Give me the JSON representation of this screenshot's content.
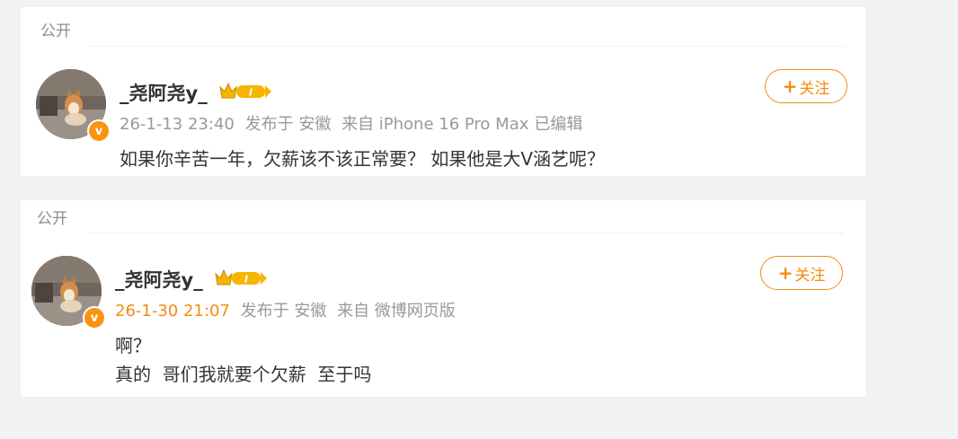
{
  "colors": {
    "accent": "#f48c10",
    "verified": "#f79412",
    "meta": "#999999"
  },
  "posts": [
    {
      "visibility": "公开",
      "username": "_尧阿尧y_",
      "badge_icon": "crown-vip-badge",
      "badge_level": "I",
      "time": "26-1-13 23:40",
      "posted_from": "发布于 安徽",
      "source": "来自 iPhone 16 Pro Max",
      "edited": "已编辑",
      "follow_label": "关注",
      "content": "如果你辛苦一年，欠薪该不该正常要？ 如果他是大V涵艺呢？"
    },
    {
      "visibility": "公开",
      "username": "_尧阿尧y_",
      "badge_icon": "crown-vip-badge",
      "badge_level": "I",
      "time": "26-1-30 21:07",
      "posted_from": "发布于 安徽",
      "source": "来自 微博网页版",
      "edited": "",
      "follow_label": "关注",
      "content": "啊？\n真的  哥们我就要个欠薪  至于吗"
    }
  ]
}
